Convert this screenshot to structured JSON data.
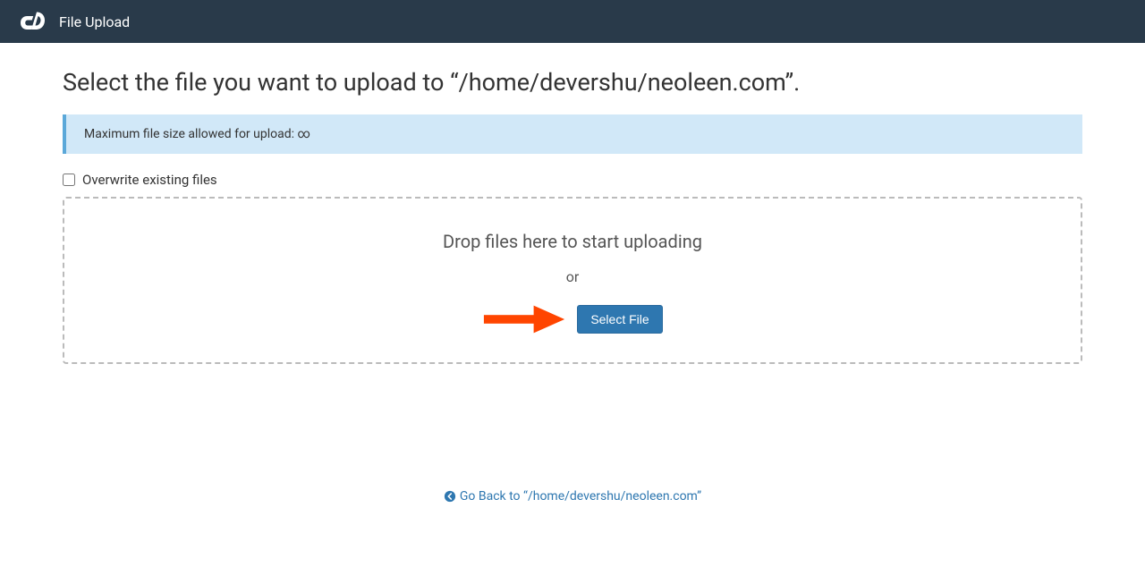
{
  "header": {
    "title": "File Upload"
  },
  "page": {
    "heading": "Select the file you want to upload to “/home/devershu/neoleen.com”."
  },
  "info_box": {
    "message": "Maximum file size allowed for upload: ∞"
  },
  "checkbox": {
    "label": "Overwrite existing files",
    "checked": false
  },
  "dropzone": {
    "title": "Drop files here to start uploading",
    "or_label": "or",
    "button_label": "Select File"
  },
  "back_link": {
    "label": "Go Back to “/home/devershu/neoleen.com”"
  }
}
